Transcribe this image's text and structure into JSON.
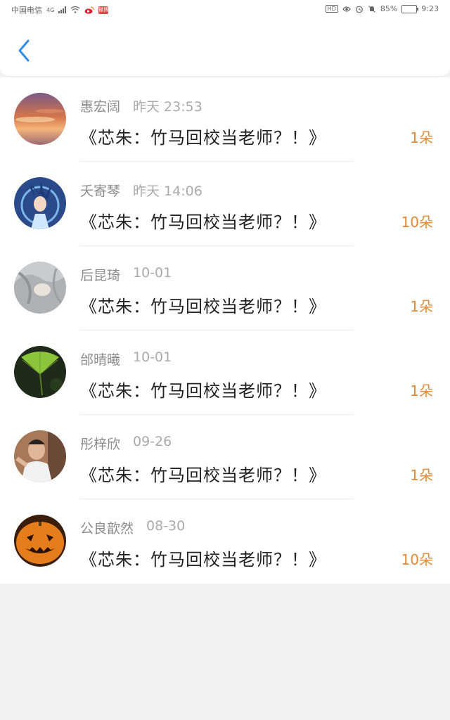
{
  "status_bar": {
    "carrier": "中国电信",
    "network": "4G",
    "notif_badge": "微博",
    "hd_label": "HD",
    "battery": "85%",
    "time": "9:23"
  },
  "header": {
    "back_icon": "chevron-left-icon"
  },
  "colors": {
    "accent": "#2e8fe5",
    "count": "#e08a3a"
  },
  "items": [
    {
      "name": "惠宏阔",
      "time": "昨天 23:53",
      "title": "《芯朱：竹马回校当老师？！》",
      "count": "1朵",
      "avatar": "sunset"
    },
    {
      "name": "夭寄琴",
      "time": "昨天 14:06",
      "title": "《芯朱：竹马回校当老师？！》",
      "count": "10朵",
      "avatar": "anime"
    },
    {
      "name": "后昆琦",
      "time": "10-01",
      "title": "《芯朱：竹马回校当老师？！》",
      "count": "1朵",
      "avatar": "grayhair"
    },
    {
      "name": "邰晴曦",
      "time": "10-01",
      "title": "《芯朱：竹马回校当老师？！》",
      "count": "1朵",
      "avatar": "ginkgo"
    },
    {
      "name": "彤梓欣",
      "time": "09-26",
      "title": "《芯朱：竹马回校当老师？！》",
      "count": "1朵",
      "avatar": "person"
    },
    {
      "name": "公良歆然",
      "time": "08-30",
      "title": "《芯朱：竹马回校当老师？！》",
      "count": "10朵",
      "avatar": "pumpkin"
    }
  ]
}
